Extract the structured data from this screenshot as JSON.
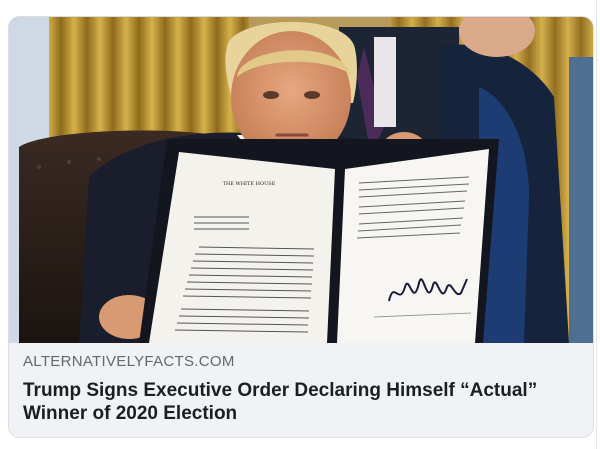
{
  "link_preview": {
    "domain": "ALTERNATIVELYFACTS.COM",
    "headline": "Trump Signs Executive Order Declaring Himself “Actual” Winner of 2020 Election",
    "image_alt": "Man in suit holding up a signed executive order folder in an office"
  },
  "document": {
    "letterhead": "THE WHITE HOUSE"
  },
  "colors": {
    "card_bg": "#f0f2f5",
    "domain_text": "#65676b",
    "headline_text": "#1c1e21",
    "curtain_gold": "#c9a23a"
  }
}
